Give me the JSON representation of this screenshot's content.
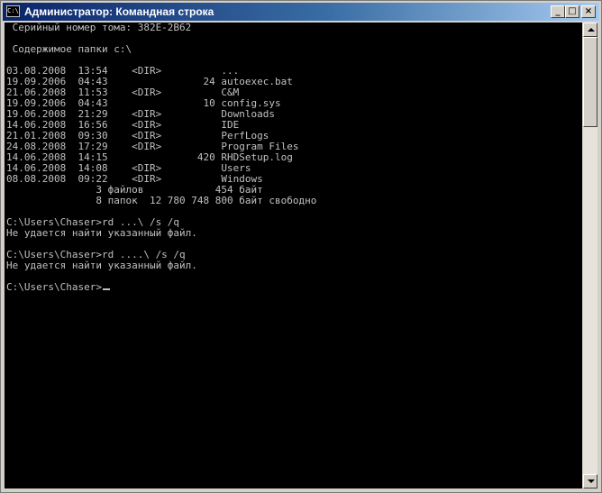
{
  "window": {
    "title": "Администратор: Командная строка",
    "icon_text": "C:\\",
    "buttons": {
      "minimize": "_",
      "maximize": "□",
      "close": "×"
    }
  },
  "console": {
    "lines": [
      " Серийный номер тома: 382E-2B62",
      "",
      " Содержимое папки c:\\",
      "",
      "03.08.2008  13:54    <DIR>          ...",
      "19.09.2006  04:43                24 autoexec.bat",
      "21.06.2008  11:53    <DIR>          C&M",
      "19.09.2006  04:43                10 config.sys",
      "19.06.2008  21:29    <DIR>          Downloads",
      "14.06.2008  16:56    <DIR>          IDE",
      "21.01.2008  09:30    <DIR>          PerfLogs",
      "24.08.2008  17:29    <DIR>          Program Files",
      "14.06.2008  14:15               420 RHDSetup.log",
      "14.06.2008  14:08    <DIR>          Users",
      "08.08.2008  09:22    <DIR>          Windows",
      "               3 файлов            454 байт",
      "               8 папок  12 780 748 800 байт свободно",
      "",
      "C:\\Users\\Chaser>rd ...\\ /s /q",
      "Не удается найти указанный файл.",
      "",
      "C:\\Users\\Chaser>rd ....\\ /s /q",
      "Не удается найти указанный файл.",
      "",
      "C:\\Users\\Chaser>"
    ]
  }
}
